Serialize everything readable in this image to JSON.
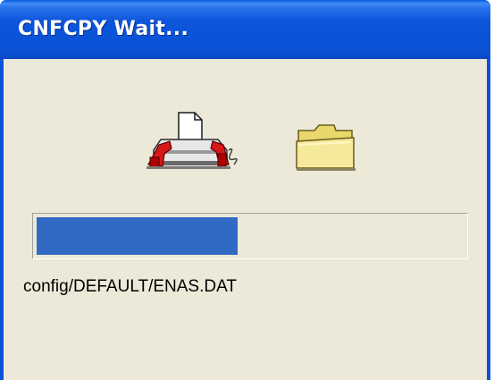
{
  "window": {
    "title": "CNFCPY Wait..."
  },
  "icons": {
    "source": "printer-icon",
    "destination": "folder-icon"
  },
  "progress": {
    "fraction": 0.47,
    "color": "#316ac5"
  },
  "status": {
    "current_file": "config/DEFAULT/ENAS.DAT"
  },
  "colors": {
    "titlebar": "#0a53d6",
    "dialog_background": "#ece9d8"
  }
}
